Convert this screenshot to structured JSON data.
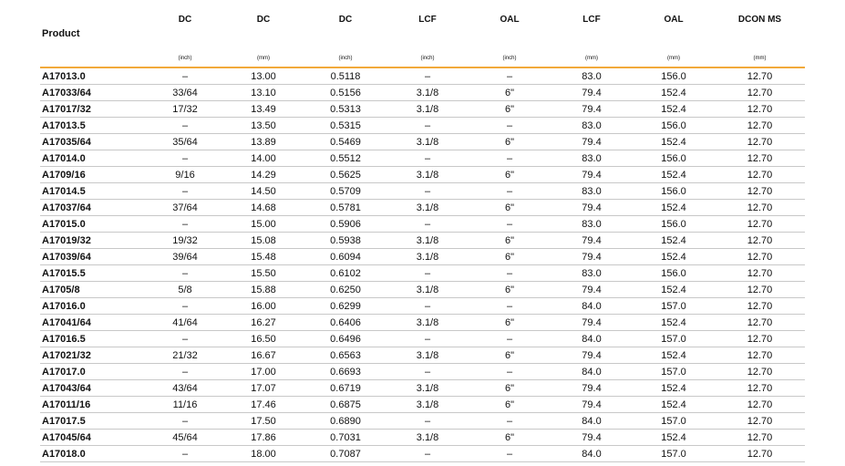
{
  "table": {
    "headers": [
      "Product",
      "DC",
      "DC",
      "DC",
      "LCF",
      "OAL",
      "LCF",
      "OAL",
      "DCON MS"
    ],
    "units": [
      "",
      "(inch)",
      "(mm)",
      "(inch)",
      "(inch)",
      "(inch)",
      "(mm)",
      "(mm)",
      "(mm)"
    ],
    "rows": [
      [
        "A17013.0",
        "–",
        "13.00",
        "0.5118",
        "–",
        "–",
        "83.0",
        "156.0",
        "12.70"
      ],
      [
        "A17033/64",
        "33/64",
        "13.10",
        "0.5156",
        "3.1/8",
        "6\"",
        "79.4",
        "152.4",
        "12.70"
      ],
      [
        "A17017/32",
        "17/32",
        "13.49",
        "0.5313",
        "3.1/8",
        "6\"",
        "79.4",
        "152.4",
        "12.70"
      ],
      [
        "A17013.5",
        "–",
        "13.50",
        "0.5315",
        "–",
        "–",
        "83.0",
        "156.0",
        "12.70"
      ],
      [
        "A17035/64",
        "35/64",
        "13.89",
        "0.5469",
        "3.1/8",
        "6\"",
        "79.4",
        "152.4",
        "12.70"
      ],
      [
        "A17014.0",
        "–",
        "14.00",
        "0.5512",
        "–",
        "–",
        "83.0",
        "156.0",
        "12.70"
      ],
      [
        "A1709/16",
        "9/16",
        "14.29",
        "0.5625",
        "3.1/8",
        "6\"",
        "79.4",
        "152.4",
        "12.70"
      ],
      [
        "A17014.5",
        "–",
        "14.50",
        "0.5709",
        "–",
        "–",
        "83.0",
        "156.0",
        "12.70"
      ],
      [
        "A17037/64",
        "37/64",
        "14.68",
        "0.5781",
        "3.1/8",
        "6\"",
        "79.4",
        "152.4",
        "12.70"
      ],
      [
        "A17015.0",
        "–",
        "15.00",
        "0.5906",
        "–",
        "–",
        "83.0",
        "156.0",
        "12.70"
      ],
      [
        "A17019/32",
        "19/32",
        "15.08",
        "0.5938",
        "3.1/8",
        "6\"",
        "79.4",
        "152.4",
        "12.70"
      ],
      [
        "A17039/64",
        "39/64",
        "15.48",
        "0.6094",
        "3.1/8",
        "6\"",
        "79.4",
        "152.4",
        "12.70"
      ],
      [
        "A17015.5",
        "–",
        "15.50",
        "0.6102",
        "–",
        "–",
        "83.0",
        "156.0",
        "12.70"
      ],
      [
        "A1705/8",
        "5/8",
        "15.88",
        "0.6250",
        "3.1/8",
        "6\"",
        "79.4",
        "152.4",
        "12.70"
      ],
      [
        "A17016.0",
        "–",
        "16.00",
        "0.6299",
        "–",
        "–",
        "84.0",
        "157.0",
        "12.70"
      ],
      [
        "A17041/64",
        "41/64",
        "16.27",
        "0.6406",
        "3.1/8",
        "6\"",
        "79.4",
        "152.4",
        "12.70"
      ],
      [
        "A17016.5",
        "–",
        "16.50",
        "0.6496",
        "–",
        "–",
        "84.0",
        "157.0",
        "12.70"
      ],
      [
        "A17021/32",
        "21/32",
        "16.67",
        "0.6563",
        "3.1/8",
        "6\"",
        "79.4",
        "152.4",
        "12.70"
      ],
      [
        "A17017.0",
        "–",
        "17.00",
        "0.6693",
        "–",
        "–",
        "84.0",
        "157.0",
        "12.70"
      ],
      [
        "A17043/64",
        "43/64",
        "17.07",
        "0.6719",
        "3.1/8",
        "6\"",
        "79.4",
        "152.4",
        "12.70"
      ],
      [
        "A17011/16",
        "11/16",
        "17.46",
        "0.6875",
        "3.1/8",
        "6\"",
        "79.4",
        "152.4",
        "12.70"
      ],
      [
        "A17017.5",
        "–",
        "17.50",
        "0.6890",
        "–",
        "–",
        "84.0",
        "157.0",
        "12.70"
      ],
      [
        "A17045/64",
        "45/64",
        "17.86",
        "0.7031",
        "3.1/8",
        "6\"",
        "79.4",
        "152.4",
        "12.70"
      ],
      [
        "A17018.0",
        "–",
        "18.00",
        "0.7087",
        "–",
        "–",
        "84.0",
        "157.0",
        "12.70"
      ]
    ]
  },
  "colors": {
    "header_rule": "#f2a93b",
    "row_rule": "#c8c8c8",
    "text": "#111111"
  }
}
